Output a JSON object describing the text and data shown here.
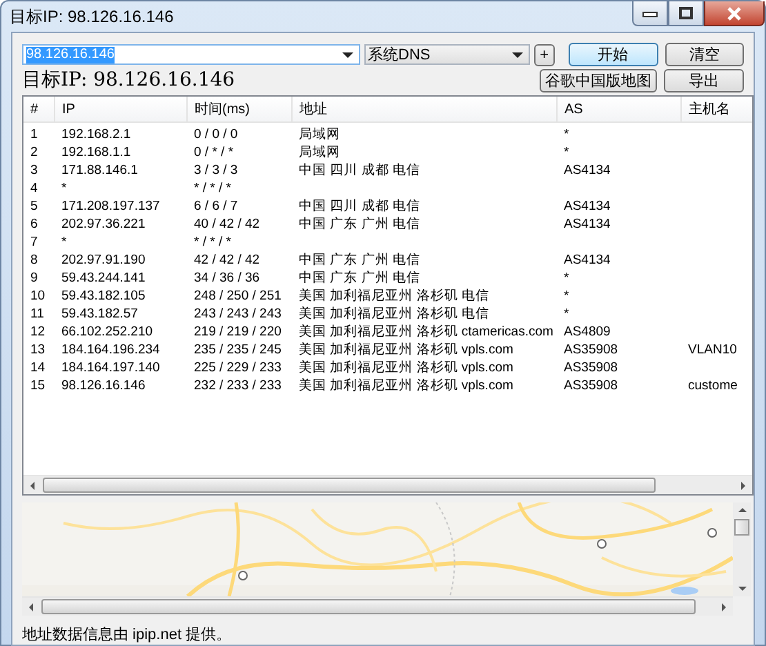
{
  "window": {
    "title": "目标IP: 98.126.16.146"
  },
  "toolbar": {
    "target_input": {
      "value": "98.126.16.146"
    },
    "dns_select": {
      "value": "系统DNS"
    },
    "buttons": [
      {
        "kind": "plus",
        "label": "+"
      },
      {
        "kind": "primary",
        "label": "开始"
      },
      {
        "kind": "normal",
        "label": "清空"
      }
    ],
    "target_label": "目标IP: 98.126.16.146",
    "buttons_2": [
      {
        "kind": "normal",
        "label": "谷歌中国版地图"
      },
      {
        "kind": "normal",
        "label": "导出"
      }
    ]
  },
  "table": {
    "columns": [
      "#",
      "IP",
      "时间(ms)",
      "地址",
      "AS",
      "主机名"
    ],
    "rows": [
      [
        "1",
        "192.168.2.1",
        "0 / 0 / 0",
        "局域网",
        "*",
        ""
      ],
      [
        "2",
        "192.168.1.1",
        "0 / * / *",
        "局域网",
        "*",
        ""
      ],
      [
        "3",
        "171.88.146.1",
        "3 / 3 / 3",
        "中国 四川 成都 电信",
        "AS4134",
        ""
      ],
      [
        "4",
        "*",
        "* / * / *",
        "",
        "",
        ""
      ],
      [
        "5",
        "171.208.197.137",
        "6 / 6 / 7",
        "中国 四川 成都 电信",
        "AS4134",
        ""
      ],
      [
        "6",
        "202.97.36.221",
        "40 / 42 / 42",
        "中国 广东 广州 电信",
        "AS4134",
        ""
      ],
      [
        "7",
        "*",
        "* / * / *",
        "",
        "",
        ""
      ],
      [
        "8",
        "202.97.91.190",
        "42 / 42 / 42",
        "中国 广东 广州 电信",
        "AS4134",
        ""
      ],
      [
        "9",
        "59.43.244.141",
        "34 / 36 / 36",
        "中国 广东 广州 电信",
        "*",
        ""
      ],
      [
        "10",
        "59.43.182.105",
        "248 / 250 / 251",
        "美国 加利福尼亚州 洛杉矶 电信",
        "*",
        ""
      ],
      [
        "11",
        "59.43.182.57",
        "243 / 243 / 243",
        "美国 加利福尼亚州 洛杉矶 电信",
        "*",
        ""
      ],
      [
        "12",
        "66.102.252.210",
        "219 / 219 / 220",
        "美国 加利福尼亚州 洛杉矶 ctamericas.com",
        "AS4809",
        ""
      ],
      [
        "13",
        "184.164.196.234",
        "235 / 235 / 245",
        "美国 加利福尼亚州 洛杉矶 vpls.com",
        "AS35908",
        "VLAN10"
      ],
      [
        "14",
        "184.164.197.140",
        "225 / 229 / 233",
        "美国 加利福尼亚州 洛杉矶 vpls.com",
        "AS35908",
        ""
      ],
      [
        "15",
        "98.126.16.146",
        "232 / 233 / 233",
        "美国 加利福尼亚州 洛杉矶 vpls.com",
        "AS35908",
        "custome"
      ]
    ]
  },
  "status_bar": "地址数据信息由 ipip.net 提供。"
}
